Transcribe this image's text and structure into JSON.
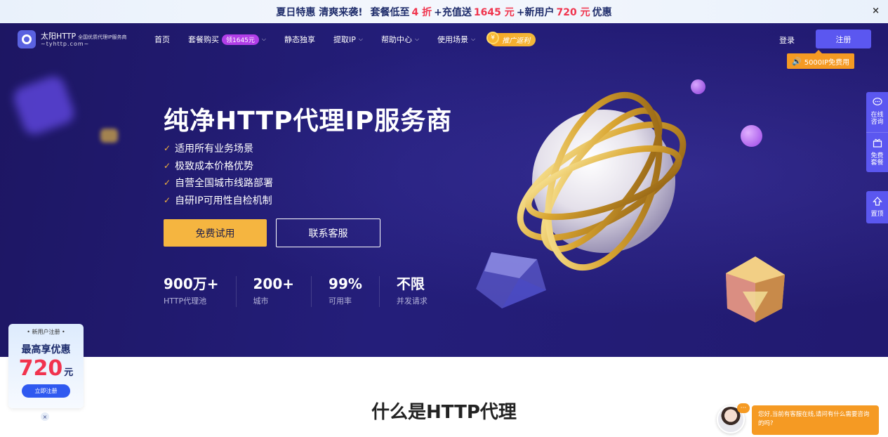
{
  "promo": {
    "part1": "夏日特惠 清爽来袭!",
    "part2": "套餐低至",
    "discount": "4 折",
    "part3": "+充值送",
    "bonus": "1645 元",
    "part4": "+新用户",
    "newuser": "720 元",
    "part5": "优惠",
    "close": "×"
  },
  "logo": {
    "name": "太阳HTTP",
    "tagline": "全国优质代理IP服务商",
    "domain": "~tyhttp.com~"
  },
  "nav": {
    "home": "首页",
    "packages": "套餐购买",
    "packages_badge": "领1645元",
    "static": "静态独享",
    "extract": "提取IP",
    "help": "帮助中心",
    "scenes": "使用场景",
    "promote": "推广返利",
    "promote_coin": "¥",
    "login": "登录",
    "register": "注册",
    "free_ip": "5000IP免费用",
    "chevron": "⌵"
  },
  "hero": {
    "title": "纯净HTTP代理IP服务商",
    "features": [
      "适用所有业务场景",
      "极致成本价格优势",
      "自营全国城市线路部署",
      "自研IP可用性自检机制"
    ],
    "check": "✓",
    "btn_trial": "免费试用",
    "btn_contact": "联系客服",
    "stats": [
      {
        "value": "900万+",
        "label": "HTTP代理池"
      },
      {
        "value": "200+",
        "label": "城市"
      },
      {
        "value": "99%",
        "label": "可用率"
      },
      {
        "value": "不限",
        "label": "并发请求"
      }
    ]
  },
  "section": {
    "title": "什么是HTTP代理"
  },
  "left_card": {
    "sub": "• 新用户注册 •",
    "title": "最高享优惠",
    "amount": "720",
    "unit": "元",
    "button": "立即注册",
    "close": "×"
  },
  "sidebar": {
    "online": "在线咨询",
    "free": "免费套餐",
    "top": "置顶"
  },
  "chat": {
    "dots": "···",
    "message": "您好,当前有客服在线,请问有什么需要咨询的吗?"
  },
  "colors": {
    "hero_bg": "#1f1868",
    "accent_purple": "#5b57f0",
    "accent_orange": "#f59a23",
    "accent_yellow": "#f5b540",
    "promo_red": "#f0344d"
  }
}
